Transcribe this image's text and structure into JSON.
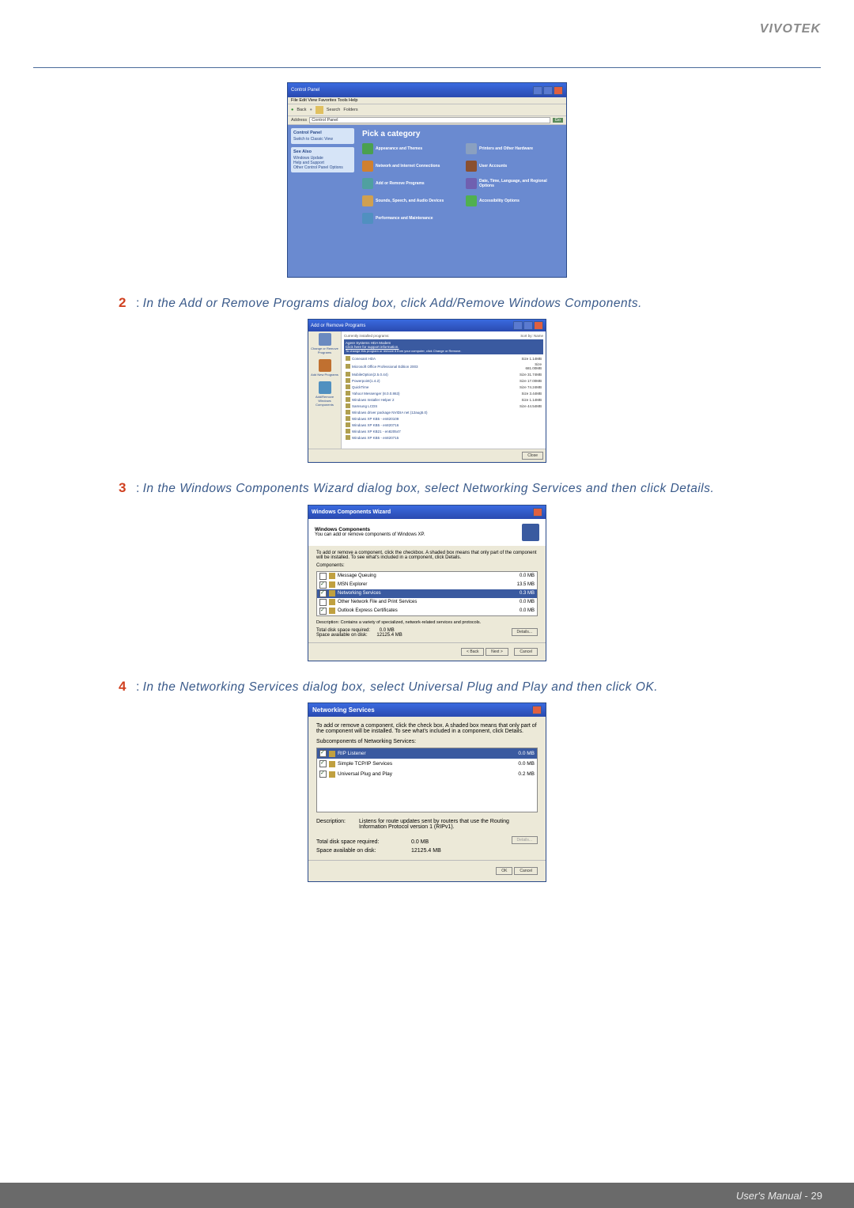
{
  "brand": "VIVOTEK",
  "footer_label": "User's Manual - ",
  "footer_page": "29",
  "steps": {
    "s2": {
      "num": "2",
      "colon": ": ",
      "prefix": "In the Add or Remove Programs dialog box, click ",
      "em": "Add/Remove Windows Components",
      "suffix": "."
    },
    "s3": {
      "num": "3",
      "colon": ": ",
      "prefix": "In the Windows Components Wizard dialog box, select Networking Services and then click ",
      "em": "Details",
      "suffix": "."
    },
    "s4": {
      "num": "4",
      "colon": ": ",
      "prefix": "In the Networking Services dialog box, select Universal Plug and Play and then click ",
      "em": "OK",
      "suffix": "."
    }
  },
  "fig1": {
    "title": "Control Panel",
    "menu": "File   Edit   View   Favorites   Tools   Help",
    "back": "Back",
    "search": "Search",
    "folders": "Folders",
    "addr_lbl": "Address",
    "addr_val": "Control Panel",
    "go": "Go",
    "side1_hdr": "Control Panel",
    "side1_a": "Switch to Classic View",
    "side2_hdr": "See Also",
    "side2_a": "Windows Update",
    "side2_b": "Help and Support",
    "side2_c": "Other Control Panel Options",
    "pick": "Pick a category",
    "cats": [
      "Appearance and Themes",
      "Printers and Other Hardware",
      "Network and Internet Connections",
      "User Accounts",
      "Add or Remove Programs",
      "Date, Time, Language, and Regional Options",
      "Sounds, Speech, and Audio Devices",
      "Accessibility Options",
      "Performance and Maintenance"
    ]
  },
  "fig2": {
    "title": "Add or Remove Programs",
    "side": [
      "Change or Remove Programs",
      "Add New Programs",
      "Add/Remove Windows Components"
    ],
    "hdr_l": "Currently installed programs:",
    "hdr_r": "Sort by: Name",
    "sel_a": "Agere Systems HDA Modem",
    "sel_b": "Click here for support information.",
    "sel_c": "To change this program or remove it from your computer, click Change or Remove.",
    "size_lbl": "Size",
    "rows": [
      {
        "name": "Conexant HDA",
        "sz": "1.14MB"
      },
      {
        "name": "Microsoft Office Professional Edition 2003",
        "sz": "681.00MB"
      },
      {
        "name": "MobileOption(2.5.0.44)",
        "sz": "31.74MB"
      },
      {
        "name": "Powerpoint(1.4.2)",
        "sz": "17.00MB"
      },
      {
        "name": "QuickTime",
        "sz": "74.24MB"
      },
      {
        "name": "Yahoo! Messenger (8.0.0.863)",
        "sz": "3.44MB"
      },
      {
        "name": "Windows Installer Helper 2",
        "sz": "1.14MB"
      },
      {
        "name": "Samsung LCDS",
        "sz": "44.54MB"
      },
      {
        "name": "Windows driver package NVIDIA net (12aug5.0)",
        "sz": ""
      },
      {
        "name": "Windows XP KB5 - en820109",
        "sz": ""
      },
      {
        "name": "Windows XP KB5 - en820716",
        "sz": ""
      },
      {
        "name": "Windows XP KB21 - en820547",
        "sz": ""
      },
      {
        "name": "Windows XP KB5 - en820715",
        "sz": ""
      }
    ],
    "close": "Close"
  },
  "fig3": {
    "title": "Windows Components Wizard",
    "hdr_b": "Windows Components",
    "hdr_t": "You can add or remove components of Windows XP.",
    "desc1": "To add or remove a component, click the checkbox. A shaded box means that only part of the component will be installed. To see what's included in a component, click Details.",
    "comp_lbl": "Components:",
    "rows": [
      {
        "chk": false,
        "name": "Message Queuing",
        "sz": "0.0 MB"
      },
      {
        "chk": true,
        "name": "MSN Explorer",
        "sz": "13.5 MB"
      },
      {
        "chk": true,
        "name": "Networking Services",
        "sz": "0.3 MB",
        "sel": true
      },
      {
        "chk": false,
        "name": "Other Network File and Print Services",
        "sz": "0.0 MB"
      },
      {
        "chk": true,
        "name": "Outlook Express Certificates",
        "sz": "0.0 MB"
      }
    ],
    "desc2_lbl": "Description:",
    "desc2": "Contains a variety of specialized, network-related services and protocols.",
    "total_lbl": "Total disk space required:",
    "total": "0.0 MB",
    "avail_lbl": "Space available on disk:",
    "avail": "12125.4 MB",
    "details": "Details...",
    "back": "< Back",
    "next": "Next >",
    "cancel": "Cancel"
  },
  "fig4": {
    "title": "Networking Services",
    "desc1": "To add or remove a component, click the check box. A shaded box means that only part of the component will be installed. To see what's included in a component, click Details.",
    "sub_lbl": "Subcomponents of Networking Services:",
    "rows": [
      {
        "chk": true,
        "name": "RIP Listener",
        "sz": "0.0 MB",
        "sel": true
      },
      {
        "chk": true,
        "name": "Simple TCP/IP Services",
        "sz": "0.0 MB"
      },
      {
        "chk": true,
        "name": "Universal Plug and Play",
        "sz": "0.2 MB"
      }
    ],
    "desc2_lbl": "Description:",
    "desc2": "Listens for route updates sent by routers that use the Routing Information Protocol version 1 (RIPv1).",
    "total_lbl": "Total disk space required:",
    "total": "0.0 MB",
    "avail_lbl": "Space available on disk:",
    "avail": "12125.4 MB",
    "details": "Details...",
    "ok": "OK",
    "cancel": "Cancel"
  }
}
